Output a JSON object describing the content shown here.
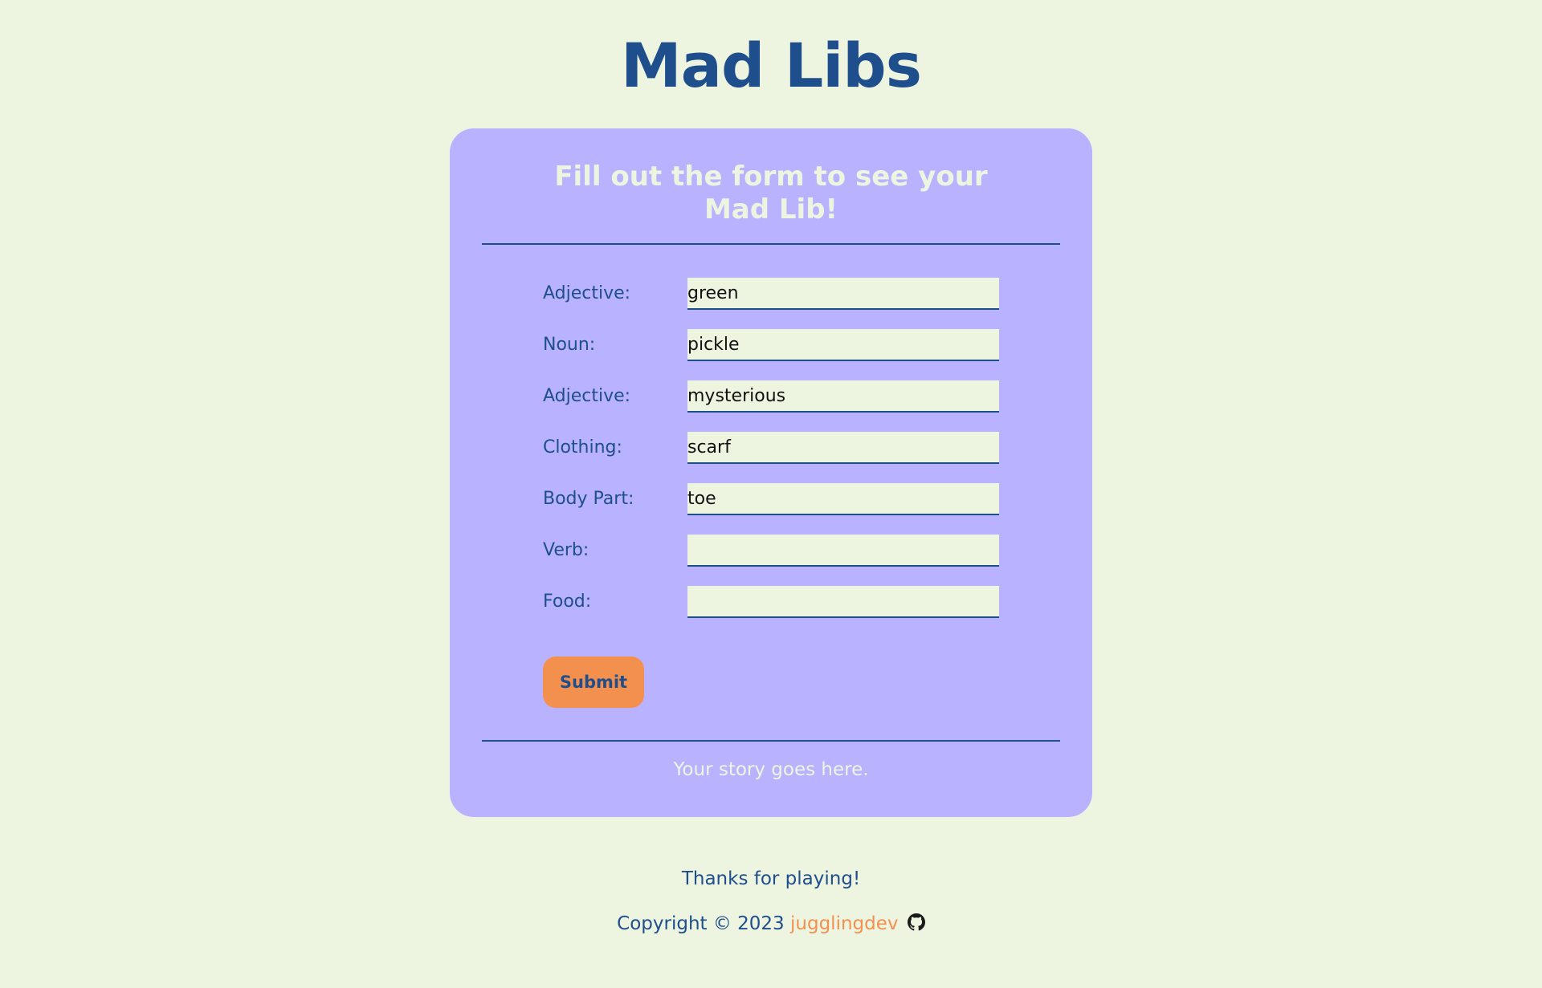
{
  "page": {
    "title": "Mad Libs"
  },
  "card": {
    "heading": "Fill out the form to see your Mad Lib!",
    "story_placeholder": "Your story goes here."
  },
  "form": {
    "fields": [
      {
        "label": "Adjective:",
        "value": "green"
      },
      {
        "label": "Noun:",
        "value": "pickle"
      },
      {
        "label": "Adjective:",
        "value": "mysterious"
      },
      {
        "label": "Clothing:",
        "value": "scarf"
      },
      {
        "label": "Body Part:",
        "value": "toe"
      },
      {
        "label": "Verb:",
        "value": ""
      },
      {
        "label": "Food:",
        "value": ""
      }
    ],
    "submit_label": "Submit"
  },
  "footer": {
    "thanks": "Thanks for playing!",
    "copyright_prefix": "Copyright © 2023",
    "author": "jugglingdev",
    "icon": "github-icon"
  },
  "colors": {
    "background": "#edf5e1",
    "card": "#b9b3ff",
    "primary": "#1f4e8c",
    "accent": "#f4904e"
  }
}
